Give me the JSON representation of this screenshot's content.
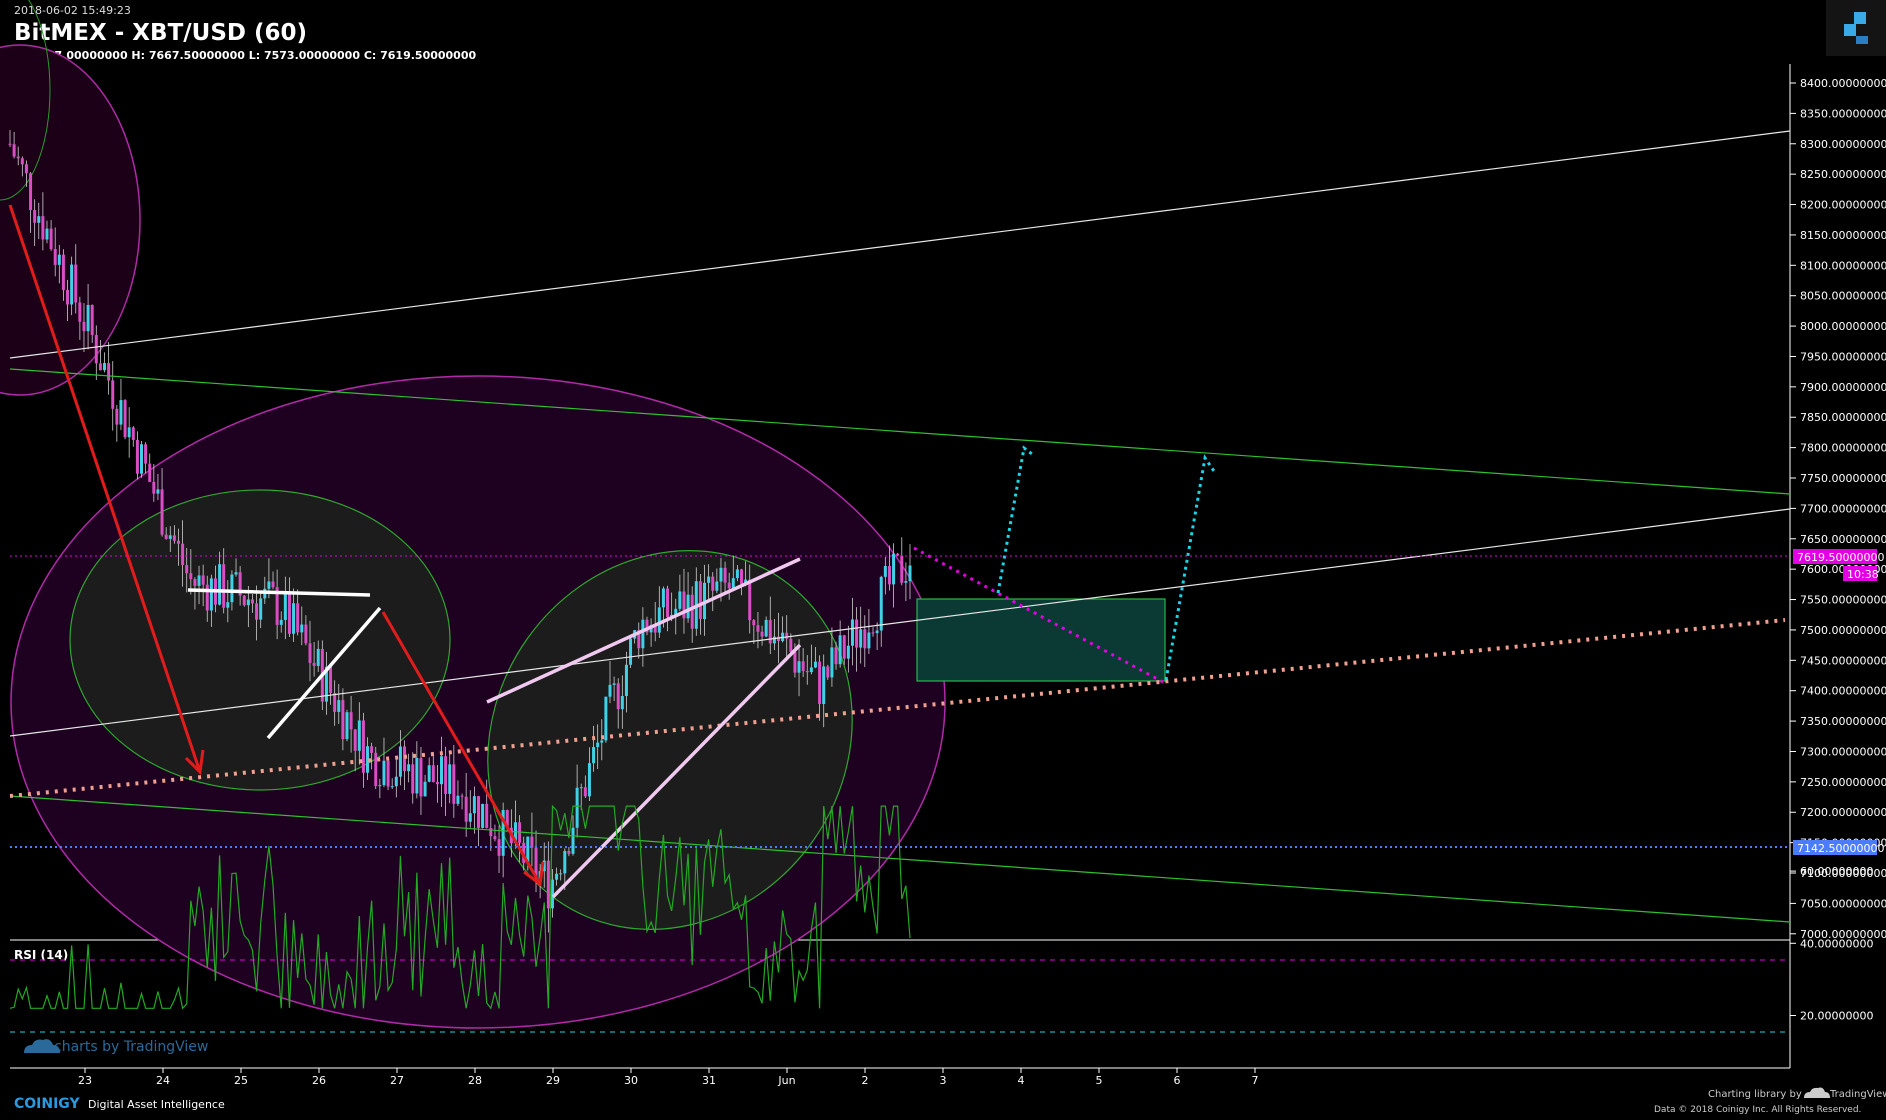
{
  "header": {
    "timestamp": "2018-06-02 15:49:23",
    "title": "BitMEX - XBT/USD (60)",
    "ohlc": "O: 7637.00000000 H: 7667.50000000 L: 7573.00000000 C: 7619.50000000"
  },
  "price_axis": {
    "ticks": [
      "8400.00000000",
      "8350.00000000",
      "8300.00000000",
      "8250.00000000",
      "8200.00000000",
      "8150.00000000",
      "8100.00000000",
      "8050.00000000",
      "8000.00000000",
      "7950.00000000",
      "7900.00000000",
      "7850.00000000",
      "7800.00000000",
      "7750.00000000",
      "7700.00000000",
      "7650.00000000",
      "7600.00000000",
      "7550.00000000",
      "7500.00000000",
      "7450.00000000",
      "7400.00000000",
      "7350.00000000",
      "7300.00000000",
      "7250.00000000",
      "7200.00000000",
      "7150.00000000",
      "7100.00000000",
      "7050.00000000",
      "7000.00000000"
    ],
    "tick_values": [
      8400,
      8350,
      8300,
      8250,
      8200,
      8150,
      8100,
      8050,
      8000,
      7950,
      7900,
      7850,
      7800,
      7750,
      7700,
      7650,
      7600,
      7550,
      7500,
      7450,
      7400,
      7350,
      7300,
      7250,
      7200,
      7150,
      7100,
      7050,
      7000
    ],
    "current_label": "7619.50000000",
    "countdown": "10:38",
    "level_label": "7142.50000000",
    "current_value": 7619.5,
    "level_value": 7142.5
  },
  "rsi": {
    "label": "RSI (14)",
    "ticks": [
      "60.00000000",
      "40.00000000",
      "20.00000000"
    ],
    "tick_values": [
      60,
      40,
      20
    ],
    "upper": 70,
    "lower": 30
  },
  "time_axis": {
    "labels": [
      "23",
      "24",
      "25",
      "26",
      "27",
      "28",
      "29",
      "30",
      "31",
      "Jun",
      "2",
      "3",
      "4",
      "5",
      "6",
      "7"
    ]
  },
  "chart_data": {
    "type": "line",
    "title": "BitMEX - XBT/USD (60)",
    "ylim": [
      7000,
      8425
    ],
    "candles_x": [
      "23",
      "24",
      "25",
      "26",
      "27",
      "28",
      "29",
      "30",
      "31",
      "Jun",
      "2"
    ],
    "close_approx": [
      8300,
      7950,
      7580,
      7540,
      7290,
      7240,
      7080,
      7510,
      7570,
      7410,
      7619.5
    ],
    "horizontal_levels": [
      7619.5,
      7142.5
    ],
    "rsi_range": [
      0,
      100
    ],
    "rsi_levels": [
      70,
      30
    ],
    "colors": {
      "background": "#000000",
      "bull": "#3fd1e6",
      "bear": "#d94ec3",
      "arrow": "#e21c1c",
      "projection": "#1ad6e6",
      "current_price": "#e400e4",
      "level": "#4a7cff",
      "rsi": "#22aa22"
    }
  },
  "footer": {
    "watermark": "charts by TradingView",
    "brand": "COINIGY",
    "tagline": "Digital Asset Intelligence",
    "charting_library": "Charting library by",
    "tv_name": "TradingView",
    "copyright": "Data © 2018 Coinigy Inc. All Rights Reserved."
  }
}
